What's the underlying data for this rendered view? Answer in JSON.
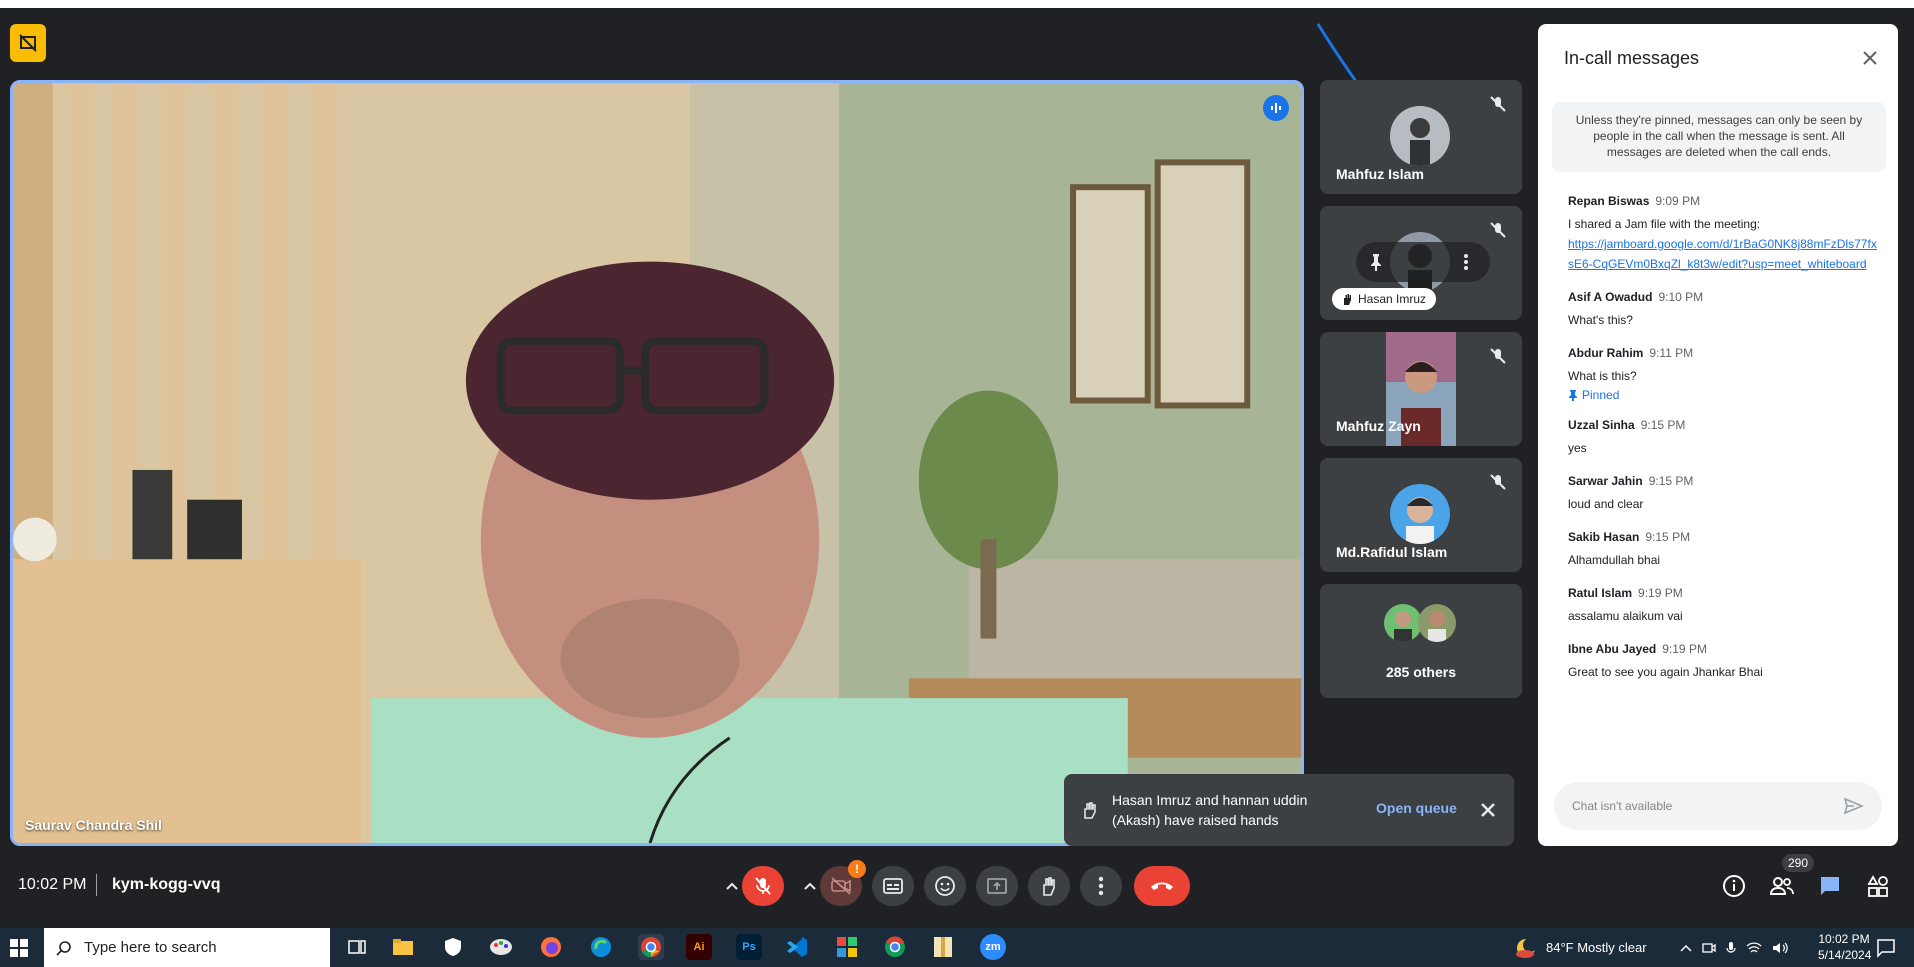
{
  "main_video": {
    "name": "Saurav Chandra Shil"
  },
  "tiles": [
    {
      "name": "Mahfuz Islam"
    },
    {
      "name": "Hasan Imruz"
    },
    {
      "name": "Mahfuz Zayn"
    },
    {
      "name": "Md.Rafidul Islam"
    },
    {
      "name": "285 others"
    }
  ],
  "chat": {
    "title": "In-call messages",
    "info": "Unless they're pinned, messages can only be seen by people in the call when the message is sent. All messages are deleted when the call ends.",
    "messages": [
      {
        "sender": "Repan Biswas",
        "time": "9:09 PM",
        "text": "I shared a Jam file with the meeting:",
        "link": "https://jamboard.google.com/d/1rBaG0NK8j88mFzDls77fxsE6-CqGEVm0BxqZl_k8t3w/edit?usp=meet_whiteboard"
      },
      {
        "sender": "Asif A Owadud",
        "time": "9:10 PM",
        "text": "What's this?"
      },
      {
        "sender": "Abdur Rahim",
        "time": "9:11 PM",
        "text": "What is this?",
        "pinned": "Pinned"
      },
      {
        "sender": "Uzzal Sinha",
        "time": "9:15 PM",
        "text": "yes"
      },
      {
        "sender": "Sarwar Jahin",
        "time": "9:15 PM",
        "text": "loud and clear"
      },
      {
        "sender": "Sakib Hasan",
        "time": "9:15 PM",
        "text": "Alhamdullah bhai"
      },
      {
        "sender": "Ratul Islam",
        "time": "9:19 PM",
        "text": "assalamu alaikum vai"
      },
      {
        "sender": "Ibne Abu Jayed",
        "time": "9:19 PM",
        "text": "Great to see you again Jhankar Bhai"
      }
    ],
    "input_placeholder": "Chat isn't available"
  },
  "toast": {
    "text": "Hasan Imruz and hannan uddin (Akash) have raised hands",
    "action": "Open queue"
  },
  "bottom": {
    "time": "10:02 PM",
    "meeting_code": "kym-kogg-vvq",
    "video_badge": "!",
    "people_count": "290"
  },
  "taskbar": {
    "search_placeholder": "Type here to search",
    "weather": "84°F  Mostly clear",
    "time": "10:02 PM",
    "date": "5/14/2024",
    "apps": [
      {
        "label": "Ai",
        "color": "#330000",
        "fg": "#ff9a00"
      },
      {
        "label": "Ps",
        "color": "#001e36",
        "fg": "#31a8ff"
      },
      {
        "label": "zm",
        "color": "#2d8cff",
        "fg": "#ffffff"
      }
    ]
  }
}
